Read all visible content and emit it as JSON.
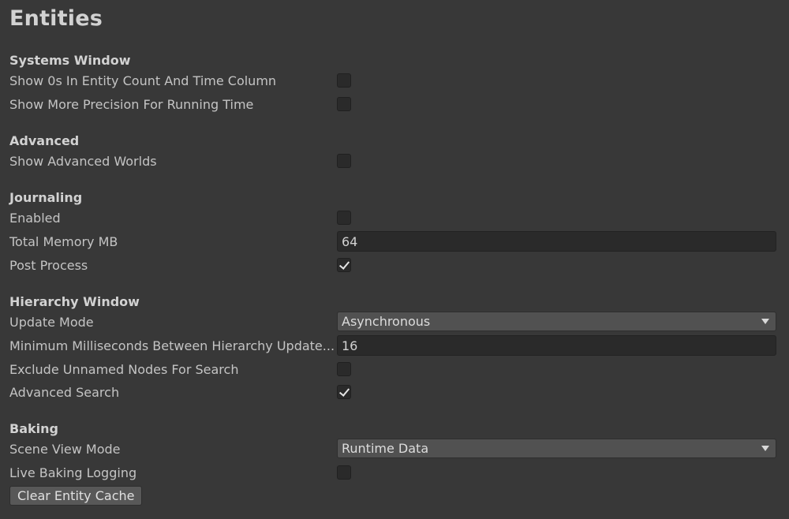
{
  "page": {
    "title": "Entities"
  },
  "systems_window": {
    "header": "Systems Window",
    "show_zeros": {
      "label": "Show 0s In Entity Count And Time Column",
      "checked": false
    },
    "more_precision": {
      "label": "Show More Precision For Running Time",
      "checked": false
    }
  },
  "advanced": {
    "header": "Advanced",
    "show_worlds": {
      "label": "Show Advanced Worlds",
      "checked": false
    }
  },
  "journaling": {
    "header": "Journaling",
    "enabled": {
      "label": "Enabled",
      "checked": false
    },
    "total_memory": {
      "label": "Total Memory MB",
      "value": "64"
    },
    "post_process": {
      "label": "Post Process",
      "checked": true
    }
  },
  "hierarchy_window": {
    "header": "Hierarchy Window",
    "update_mode": {
      "label": "Update Mode",
      "value": "Asynchronous"
    },
    "min_ms": {
      "label": "Minimum Milliseconds Between Hierarchy Update...",
      "value": "16"
    },
    "exclude_unnamed": {
      "label": "Exclude Unnamed Nodes For Search",
      "checked": false
    },
    "advanced_search": {
      "label": "Advanced Search",
      "checked": true
    }
  },
  "baking": {
    "header": "Baking",
    "scene_view_mode": {
      "label": "Scene View Mode",
      "value": "Runtime Data"
    },
    "live_logging": {
      "label": "Live Baking Logging",
      "checked": false
    },
    "clear_cache_label": "Clear Entity Cache"
  },
  "colors": {
    "background": "#383838",
    "field": "#2a2a2a",
    "dropdown": "#515151",
    "button": "#585858",
    "text": "#c4c4c4"
  },
  "icons": {
    "checkmark": "checkmark-icon",
    "dropdown_arrow": "chevron-down-icon"
  }
}
